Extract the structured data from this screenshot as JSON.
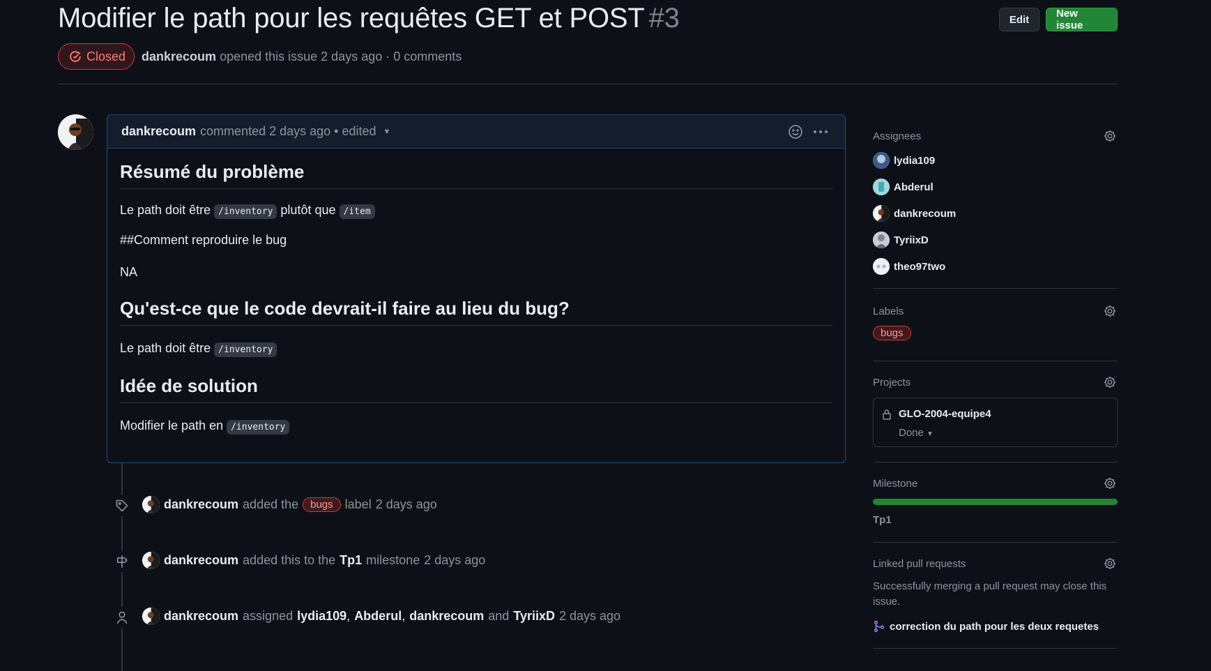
{
  "issue": {
    "title": "Modifier le path pour les requêtes GET et POST",
    "number": "#3",
    "state": "Closed",
    "author": "dankrecoum",
    "opened_text": "opened this issue 2 days ago · 0 comments"
  },
  "header_buttons": {
    "edit": "Edit",
    "new_issue": "New issue"
  },
  "comment": {
    "author": "dankrecoum",
    "meta": "commented 2 days ago • edited",
    "sections": [
      {
        "heading": "Résumé du problème"
      },
      {
        "text_before": "Le path doit être",
        "code1": "/inventory",
        "text_mid": "plutôt que",
        "code2": "/item"
      },
      {
        "text": "##Comment reproduire le bug"
      },
      {
        "text": "NA"
      },
      {
        "heading": "Qu'est-ce que le code devrait-il faire au lieu du bug?"
      },
      {
        "text_before": "Le path doit être",
        "code1": "/inventory"
      },
      {
        "heading": "Idée de solution"
      },
      {
        "text_before": "Modifier le path en",
        "code1": "/inventory"
      }
    ]
  },
  "timeline": [
    {
      "actor": "dankrecoum",
      "before": "added the",
      "label": "bugs",
      "after": "label",
      "time": "2 days ago"
    },
    {
      "actor": "dankrecoum",
      "before": "added this to the",
      "milestone": "Tp1",
      "after": "milestone",
      "time": "2 days ago"
    },
    {
      "actor": "dankrecoum",
      "before": "assigned",
      "assignees": [
        "lydia109",
        "Abderul",
        "dankrecoum"
      ],
      "and": "and",
      "last": "TyriixD",
      "time": "2 days ago"
    }
  ],
  "sidebar": {
    "assignees_title": "Assignees",
    "assignees": [
      "lydia109",
      "Abderul",
      "dankrecoum",
      "TyriixD",
      "theo97two"
    ],
    "labels_title": "Labels",
    "labels": [
      "bugs"
    ],
    "projects_title": "Projects",
    "project_name": "GLO-2004-equipe4",
    "project_status": "Done",
    "milestone_title": "Milestone",
    "milestone_progress": 1.0,
    "milestone_name": "Tp1",
    "linked_title": "Linked pull requests",
    "linked_desc": "Successfully merging a pull request may close this issue.",
    "linked_pr": "correction du path pour les deux requetes"
  },
  "colors": {
    "accent_green": "#238636",
    "closed_red": "#da3633",
    "bg": "#0d1117"
  }
}
